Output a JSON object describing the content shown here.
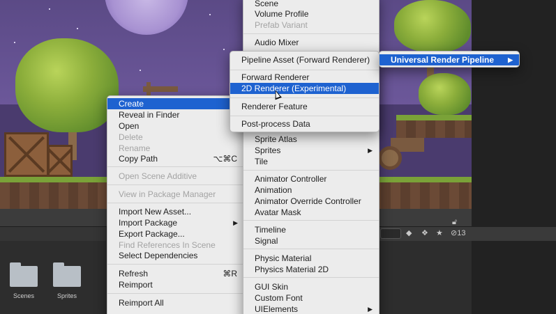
{
  "context_menu": {
    "items": [
      {
        "label": "Create",
        "selected": true,
        "submenu": true
      },
      {
        "label": "Reveal in Finder"
      },
      {
        "label": "Open"
      },
      {
        "label": "Delete",
        "disabled": true
      },
      {
        "label": "Rename",
        "disabled": true
      },
      {
        "label": "Copy Path",
        "shortcut": "⌥⌘C"
      },
      {
        "label": "Open Scene Additive",
        "disabled": true
      },
      {
        "label": "View in Package Manager",
        "disabled": true
      },
      {
        "label": "Import New Asset..."
      },
      {
        "label": "Import Package",
        "submenu": true
      },
      {
        "label": "Export Package..."
      },
      {
        "label": "Find References In Scene",
        "disabled": true
      },
      {
        "label": "Select Dependencies"
      },
      {
        "label": "Refresh",
        "shortcut": "⌘R"
      },
      {
        "label": "Reimport"
      },
      {
        "label": "Reimport All"
      }
    ]
  },
  "create_menu": {
    "items": [
      {
        "label": "Scene"
      },
      {
        "label": "Volume Profile"
      },
      {
        "label": "Prefab Variant",
        "disabled": true
      },
      {
        "label": "Audio Mixer"
      },
      {
        "label": "Sprite Atlas"
      },
      {
        "label": "Sprites",
        "submenu": true
      },
      {
        "label": "Tile"
      },
      {
        "label": "Animator Controller"
      },
      {
        "label": "Animation"
      },
      {
        "label": "Animator Override Controller"
      },
      {
        "label": "Avatar Mask"
      },
      {
        "label": "Timeline"
      },
      {
        "label": "Signal"
      },
      {
        "label": "Physic Material"
      },
      {
        "label": "Physics Material 2D"
      },
      {
        "label": "GUI Skin"
      },
      {
        "label": "Custom Font"
      },
      {
        "label": "UIElements",
        "submenu": true
      }
    ]
  },
  "rendering_menu": {
    "items": [
      {
        "label": "Pipeline Asset (Forward Renderer)"
      },
      {
        "label": "Forward Renderer"
      },
      {
        "label": "2D Renderer (Experimental)",
        "selected": true
      },
      {
        "label": "Renderer Feature"
      },
      {
        "label": "Post-process Data"
      }
    ]
  },
  "urp_menu": {
    "items": [
      {
        "label": "Universal Render Pipeline",
        "selected": true,
        "submenu": true
      }
    ]
  },
  "project": {
    "assets": [
      {
        "label": "Scenes",
        "icon": "folder-icon"
      },
      {
        "label": "Sprites",
        "icon": "folder-icon"
      }
    ],
    "toolbar": {
      "hidden_count": "13"
    }
  },
  "colors": {
    "highlight": "#1e62d0",
    "menu_bg": "#ececec",
    "disabled": "#a3a3a3"
  }
}
